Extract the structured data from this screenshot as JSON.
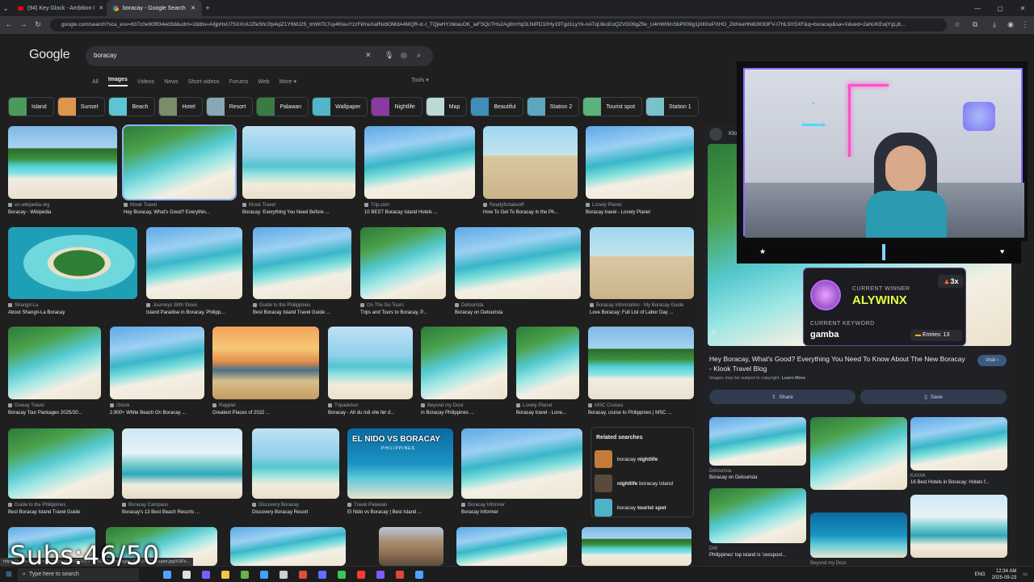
{
  "browser": {
    "tabs": [
      {
        "label": "(94) Key Glock - Ambition I"
      },
      {
        "label": "boracay - Google Search"
      }
    ],
    "url": "google.com/search?sca_esv=637c0e90f834ed3d&udm=2&tbs=AIljpHxU7SXXniUZfeShr2fp4qiZ1Y6MJ25_tmWITc7uy4KleuYzzFkfneXafNx6OMdA4MQR-lc-t_TQjwHYzlklauOK_iaFSQcTHs2AgItmYqOLNIPD10Hy19Tgd1LyYk-nATqUikoEoQZVG09gZfie_U4HWWnSbP009g1jXKhxPXHO_ZkKkeHNi63K93FV-I7HL9XSXF&q=boracay&sa=X&ved=2ahUKEwjYgLj6...",
    "status_url": "https://s-cms-production.imgix.net/%2F2019-06%2FGettyImages-483535221_super.jpg%3Fs..."
  },
  "search": {
    "logo": "Google",
    "query": "boracay"
  },
  "nav": {
    "tabs": [
      {
        "label": "All"
      },
      {
        "label": "Images"
      },
      {
        "label": "Videos"
      },
      {
        "label": "News"
      },
      {
        "label": "Short videos"
      },
      {
        "label": "Forums"
      },
      {
        "label": "Web"
      },
      {
        "label": "More ▾"
      }
    ],
    "tools": "Tools ▾"
  },
  "chips": [
    {
      "label": "Island",
      "color": "#4c9a5b"
    },
    {
      "label": "Sunset",
      "color": "#e0954c"
    },
    {
      "label": "Beach",
      "color": "#5cc4d2"
    },
    {
      "label": "Hotel",
      "color": "#7a8d6a"
    },
    {
      "label": "Resort",
      "color": "#8aa7b5"
    },
    {
      "label": "Palawan",
      "color": "#3a7b44"
    },
    {
      "label": "Wallpaper",
      "color": "#4fb7c9"
    },
    {
      "label": "Nightlife",
      "color": "#8a3aa0"
    },
    {
      "label": "Map",
      "color": "#bcd9d5"
    },
    {
      "label": "Beautiful",
      "color": "#3f8fb8"
    },
    {
      "label": "Station 2",
      "color": "#5ea6c0"
    },
    {
      "label": "Tourist spot",
      "color": "#5cb27a"
    },
    {
      "label": "Station 1",
      "color": "#79c2c9"
    }
  ],
  "results": {
    "r1": [
      {
        "source": "en.wikipedia.org",
        "title": "Boracay - Wikipedia"
      },
      {
        "source": "Klook Travel",
        "title": "Hey Boracay, What's Good? Everythin..."
      },
      {
        "source": "Klook Travel",
        "title": "Boracay: Everything You Need Before ..."
      },
      {
        "source": "Trip.com",
        "title": "10 BEST Boracay Island Hotels ..."
      },
      {
        "source": "Readyfortakeoff",
        "title": "How To Get To Boracay in the Ph..."
      },
      {
        "source": "Lonely Planet",
        "title": "Boracay travel - Lonely Planet"
      }
    ],
    "r2": [
      {
        "source": "Shangri-La",
        "title": "About Shangri-La Boracay"
      },
      {
        "source": "Journeys With Steve",
        "title": "Island Paradise in Boracay, Philipp..."
      },
      {
        "source": "Guide to the Philippines",
        "title": "Best Boracay Island Travel Guide ..."
      },
      {
        "source": "On The Go Tours",
        "title": "Trips and Tours to Boracay, P..."
      },
      {
        "source": "Detourista",
        "title": "Boracay on Detourista"
      },
      {
        "source": "Boracay Information - My Boracay Guide",
        "title": "Love Boracay: Full List of Labor Day ..."
      }
    ],
    "r3": [
      {
        "source": "Goway Travel",
        "title": "Boracay Tour Packages 2025/20..."
      },
      {
        "source": "iStock",
        "title": "2,900+ White Beach On Boracay ..."
      },
      {
        "source": "Rappler",
        "title": "Greatest Places of 2022 ..."
      },
      {
        "source": "Tripadvisor",
        "title": "Boracay - Alt du må vite før d..."
      },
      {
        "source": "Beyond my Door",
        "title": "in Boracay Philippines ..."
      },
      {
        "source": "Lonely Planet",
        "title": "Boracay travel - Lone..."
      },
      {
        "source": "MSC Cruises",
        "title": "Boracay, cruise to Philippines | MSC ..."
      }
    ],
    "r4": [
      {
        "source": "Guide to the Philippines",
        "title": "Best Boracay Island Travel Guide"
      },
      {
        "source": "Boracay Campass",
        "title": "Boracay's 13 Best Beach Resorts ..."
      },
      {
        "source": "Discovery Boracay",
        "title": "Discovery Boracay Resort"
      },
      {
        "source": "Travel Palawan",
        "title": "El Nido vs Boracay | Best Island ..."
      },
      {
        "source": "Boracay Informer",
        "title": "Boracay Informer"
      }
    ],
    "nido_text": "EL NIDO VS BORACAY",
    "nido_sub": "PHILIPPINES"
  },
  "related": {
    "title": "Related searches",
    "items": [
      {
        "prefix": "boracay ",
        "bold": "nightlife",
        "suffix": "",
        "color": "#c47b3a"
      },
      {
        "prefix": "",
        "bold": "nightlife",
        "suffix": " boracay island",
        "color": "#5a4a3a"
      },
      {
        "prefix": "boracay ",
        "bold": "tourist spot",
        "suffix": "",
        "color": "#4fb2c8"
      }
    ]
  },
  "panel": {
    "source": "Klo",
    "title": "Hey Boracay, What's Good? Everything You Need To Know About The New Boracay - Klook Travel Blog",
    "copyright": "Images may be subject to copyright.",
    "learn_more": "Learn More",
    "visit": "Visit",
    "share": "Share",
    "save": "Save",
    "items": [
      {
        "source": "Detourista",
        "title": "Boracay on Detourista"
      },
      {
        "source": "",
        "title": ""
      },
      {
        "source": "KAYAK",
        "title": "16 Best Hotels in Boracay: Hotels f..."
      },
      {
        "source": "DW",
        "title": "Philippines' top island is 'cesspool..."
      },
      {
        "source": "Beyond my Door",
        "title": "in Boracay Philippines ..."
      },
      {
        "source": "",
        "title": ""
      }
    ]
  },
  "stream": {
    "winner_label": "CURRENT WINNER",
    "winner_name": "ALYWINX",
    "streak": "3x",
    "keyword_label": "CURRENT KEYWORD",
    "keyword": "gamba",
    "entries": "Entries: 13",
    "subs": "Subs:46/50"
  },
  "taskbar": {
    "search": "Type here to search",
    "time": "12:34 AM",
    "date": "2025-09-23",
    "lang": "ENG"
  }
}
